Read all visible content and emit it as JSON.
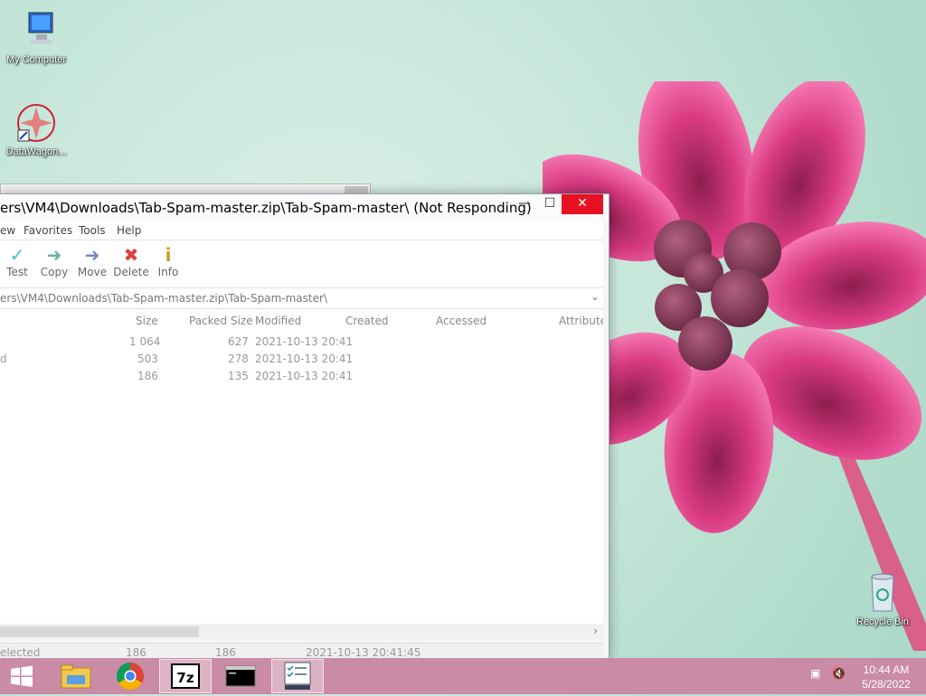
{
  "desktop": {
    "icons": [
      {
        "label": "My Computer"
      },
      {
        "label": "DataWagon..."
      },
      {
        "label": "Recycle Bin"
      }
    ]
  },
  "window": {
    "title": "ers\\VM4\\Downloads\\Tab-Spam-master.zip\\Tab-Spam-master\\ (Not Responding)",
    "menu": [
      "ew",
      "Favorites",
      "Tools",
      "Help"
    ],
    "toolbar": [
      "Test",
      "Copy",
      "Move",
      "Delete",
      "Info"
    ],
    "address": "ers\\VM4\\Downloads\\Tab-Spam-master.zip\\Tab-Spam-master\\",
    "columns": [
      "Size",
      "Packed Size",
      "Modified",
      "Created",
      "Accessed",
      "Attribute"
    ],
    "rows": [
      {
        "name": "",
        "size": "1 064",
        "packed": "627",
        "modified": "2021-10-13 20:41"
      },
      {
        "name": "d",
        "size": "503",
        "packed": "278",
        "modified": "2021-10-13 20:41"
      },
      {
        "name": "",
        "size": "186",
        "packed": "135",
        "modified": "2021-10-13 20:41"
      }
    ],
    "status": {
      "selected": "elected",
      "size": "186",
      "packed": "186",
      "modified": "2021-10-13 20:41:45"
    }
  },
  "taskbar": {
    "time": "10:44 AM",
    "date": "5/28/2022",
    "accent": "#c98ba6"
  }
}
